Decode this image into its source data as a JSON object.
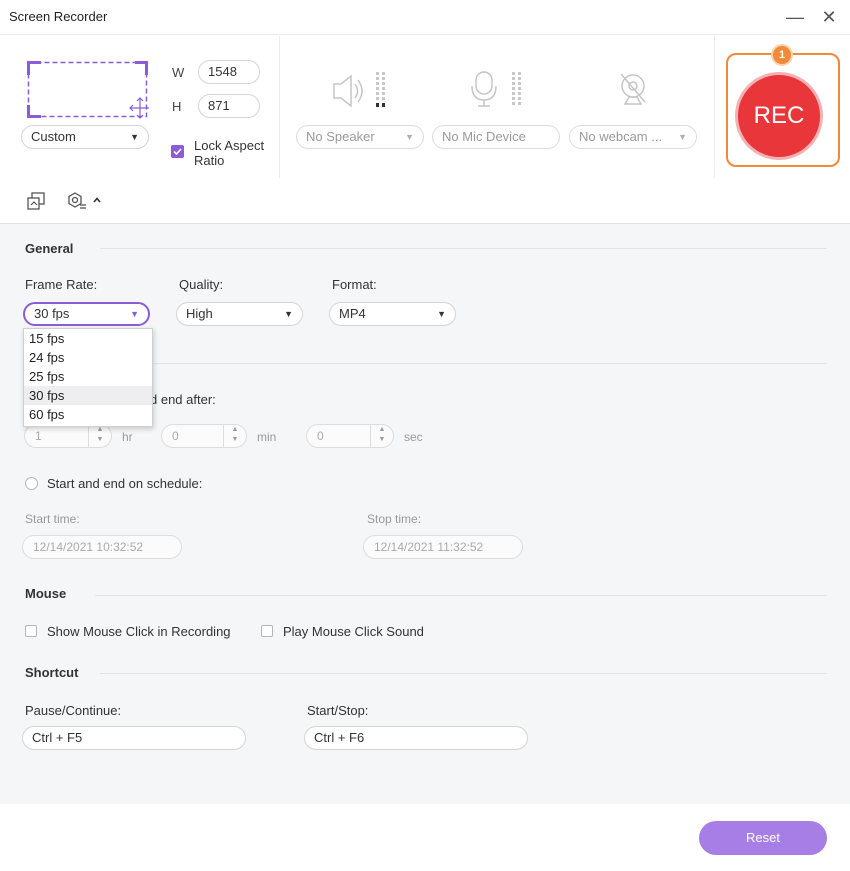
{
  "window": {
    "title": "Screen Recorder",
    "minimize": "—",
    "close": "✕"
  },
  "capture": {
    "w_label": "W",
    "w_value": "1548",
    "h_label": "H",
    "h_value": "871",
    "mode": "Custom",
    "lock_aspect_checked": true,
    "lock_aspect_label_1": "Lock Aspect",
    "lock_aspect_label_2": "Ratio"
  },
  "devices": {
    "speaker": "No Speaker",
    "mic": "No Mic Device",
    "webcam": "No webcam ..."
  },
  "rec": {
    "label": "REC",
    "badge": "1"
  },
  "colors": {
    "accent": "#a77de6",
    "rec": "#e8363a",
    "highlight": "#f08a3a"
  },
  "general": {
    "title": "General",
    "frame_rate_label": "Frame Rate:",
    "frame_rate_value": "30 fps",
    "quality_label": "Quality:",
    "quality_value": "High",
    "format_label": "Format:",
    "format_value": "MP4",
    "fps_options": [
      "15 fps",
      "24 fps",
      "25 fps",
      "30 fps",
      "60 fps"
    ]
  },
  "schedule": {
    "end_after_label": "d end after:",
    "hr_value": "1",
    "hr_unit": "hr",
    "min_value": "0",
    "min_unit": "min",
    "sec_value": "0",
    "sec_unit": "sec",
    "schedule_label": "Start and end on schedule:",
    "start_label": "Start time:",
    "start_value": "12/14/2021 10:32:52",
    "stop_label": "Stop time:",
    "stop_value": "12/14/2021 11:32:52"
  },
  "mouse": {
    "title": "Mouse",
    "show_click": "Show Mouse Click in Recording",
    "play_sound": "Play Mouse Click Sound"
  },
  "shortcut": {
    "title": "Shortcut",
    "pause_label": "Pause/Continue:",
    "pause_value": "Ctrl + F5",
    "start_label": "Start/Stop:",
    "start_value": "Ctrl + F6"
  },
  "footer": {
    "reset": "Reset"
  }
}
